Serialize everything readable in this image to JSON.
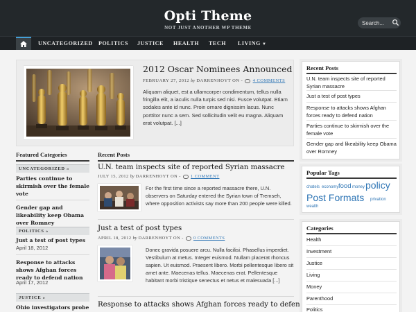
{
  "site": {
    "title": "Opti Theme",
    "tagline": "NOT JUST ANOTHER WP THEME"
  },
  "search": {
    "placeholder": "Search..."
  },
  "nav": {
    "items": [
      "UNCATEGORIZED",
      "POLITICS",
      "JUSTICE",
      "HEALTH",
      "TECH",
      "LIVING"
    ]
  },
  "featured": {
    "title": "2012 Oscar Nominees Announced",
    "date": "FEBRUARY 27, 2012",
    "by": "by",
    "author": "DARRENHOYT",
    "on": "ON -",
    "comments": "4 COMMENTS",
    "excerpt": "Aliquam aliquet, est a ullamcorper condimentum, tellus nulla fringilla elit, a iaculis nulla turpis sed nisi. Fusce volutpat. Etiam sodales ante id nunc. Proin ornare dignissim lacus. Nunc porttitor nunc a sem. Sed sollicitudin velit eu magna. Aliquam erat volutpat. [...]"
  },
  "featured_categories": {
    "heading": "Featured Categories",
    "groups": [
      {
        "label": "UNCATEGORIZED »",
        "posts": [
          {
            "title": "Parties continue to skirmish over the female vote",
            "date": ""
          },
          {
            "title": "Gender gap and likeability keep Obama over Romney",
            "date": ""
          }
        ]
      },
      {
        "label": "POLITICS »",
        "posts": [
          {
            "title": "Just a test of post types",
            "date": "April 18, 2012"
          },
          {
            "title": "Response to attacks shows Afghan forces ready to defend nation",
            "date": "April 17, 2012"
          }
        ]
      },
      {
        "label": "JUSTICE »",
        "posts": [
          {
            "title": "Ohio investigators probe",
            "date": ""
          }
        ]
      }
    ]
  },
  "recent_posts": {
    "heading": "Recent Posts",
    "posts": [
      {
        "title": "U.N. team inspects site of reported Syrian massacre",
        "date": "JULY 15, 2012",
        "by": "by",
        "author": "DARRENHOYT",
        "on": "ON -",
        "comments": "1 COMMENT",
        "excerpt": "For the first time since a reported massacre there, U.N. observers on Saturday entered the Syrian town of Tremseh, where opposition activists say more than 200 people were killed."
      },
      {
        "title": "Just a test of post types",
        "date": "APRIL 18, 2012",
        "by": "by",
        "author": "DARRENHOYT",
        "on": "ON -",
        "comments": "0 COMMENTS",
        "excerpt": "Donec gravida posuere arcu. Nulla facilisi. Phasellus imperdiet. Vestibulum at metus. Integer euismod. Nullam placerat rhoncus sapien. Ut euismod. Praesent libero. Morbi pellentesque libero sit amet ante. Maecenas tellus. Maecenas erat. Pellentesque habitant morbi tristique senectus et netus et malesuada [...]"
      },
      {
        "title": "Response to attacks shows Afghan forces ready to defend"
      }
    ]
  },
  "sidebar": {
    "recent": {
      "heading": "Recent Posts",
      "items": [
        "U.N. team inspects site of reported Syrian massacre",
        "Just a test of post types",
        "Response to attacks shows Afghan forces ready to defend nation",
        "Parties continue to skirmish over the female vote",
        "Gender gap and likeability keep Obama over Romney"
      ]
    },
    "tags": {
      "heading": "Popular Tags",
      "items": [
        "chatels",
        "economy",
        "food",
        "money",
        "policy",
        "Post Formats",
        "privation",
        "wealth"
      ]
    },
    "categories": {
      "heading": "Categories",
      "items": [
        "Health",
        "Investment",
        "Justice",
        "Living",
        "Money",
        "Parenthood",
        "Politics"
      ]
    }
  },
  "colors": {
    "header_bg": "#23282b",
    "nav_bg": "#1e2225",
    "nav_accent": "#44a0d8",
    "link": "#2e75b5"
  }
}
